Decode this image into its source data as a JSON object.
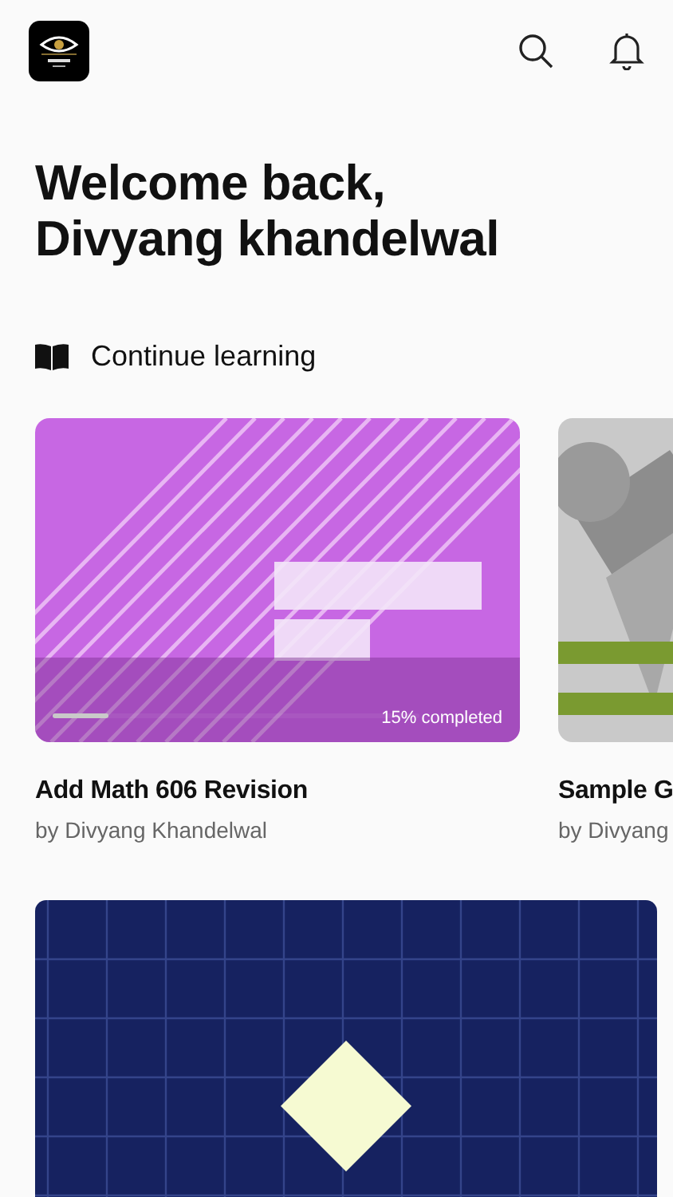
{
  "header": {
    "title_lines": [
      "Welcome back,",
      "Divyang khandelwal"
    ]
  },
  "section": {
    "title": "Continue learning"
  },
  "courses": [
    {
      "kind": "purple",
      "title": "Add Math 606 Revision",
      "author": "by Divyang Khandelwal",
      "progress_text": "15% completed",
      "level": 0.15
    },
    {
      "kind": "gray",
      "title": "Sample G",
      "author": "by Divyang"
    }
  ]
}
